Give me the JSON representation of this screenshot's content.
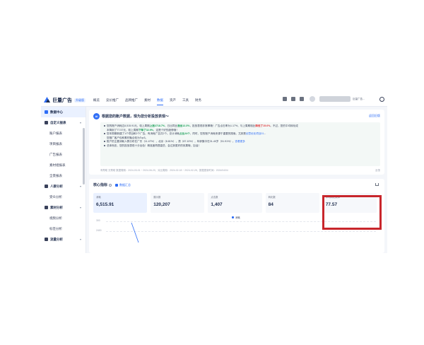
{
  "app": {
    "logo_text": "巨量广告",
    "logo_badge": "升级版"
  },
  "nav": {
    "items": [
      "概览",
      "竞价推广",
      "品牌推广",
      "素材",
      "数据",
      "资产",
      "工具",
      "财务"
    ],
    "active_index": 4
  },
  "top_right": {
    "user_name": "巨量广告..."
  },
  "sidebar": {
    "items": [
      {
        "label": "数据中心",
        "type": "group",
        "active": true
      },
      {
        "label": "自定义报表",
        "type": "group"
      },
      {
        "label": "账户报表",
        "type": "item"
      },
      {
        "label": "项目报表",
        "type": "item"
      },
      {
        "label": "广告报表",
        "type": "item"
      },
      {
        "label": "素材组报表",
        "type": "item"
      },
      {
        "label": "全景报表",
        "type": "item"
      },
      {
        "label": "人群分析",
        "type": "group"
      },
      {
        "label": "受众分析",
        "type": "item"
      },
      {
        "label": "素材分析",
        "type": "group"
      },
      {
        "label": "视频分析",
        "type": "item"
      },
      {
        "label": "标签分析",
        "type": "item"
      },
      {
        "label": "流量分析",
        "type": "group"
      }
    ]
  },
  "insight": {
    "icon_label": "AI",
    "title": "根据您的账户数据，现为您分析投放表现～",
    "link": "返回旧版",
    "lines": [
      {
        "parts": [
          [
            "n",
            "您的账户消耗达"
          ],
          [
            "n",
            "6,515.91元"
          ],
          [
            "n",
            "，较上周期"
          ],
          [
            "g",
            "上涨2718.7%"
          ],
          [
            "n",
            "，日出同比"
          ],
          [
            "g",
            "涨出12.3%"
          ],
          [
            "n",
            "，投放表现非常棒哦！广告点击率为1.17%，与上周期相比"
          ],
          [
            "r",
            "降低了15.6%"
          ],
          [
            "n",
            "。不过，您的平均转化成"
          ]
        ],
        "dot": true
      },
      {
        "parts": [
          [
            "n",
            "本降到了"
          ],
          [
            "n",
            "77.57元"
          ],
          [
            "n",
            "，较上周期"
          ],
          [
            "g",
            "下降了32.9%"
          ],
          [
            "n",
            "，这是个好的趋势哦！"
          ]
        ],
        "dot": false
      },
      {
        "parts": [
          [
            "n",
            "您本周期新建了1个项目和2个广告。有消耗广告共"
          ],
          [
            "n",
            "2"
          ],
          [
            "n",
            "个。总计消耗"
          ],
          [
            "g",
            "占比24个"
          ],
          [
            "n",
            "，同时，您的账户消耗来源于重要的搜索。尤其是"
          ],
          [
            "b",
            "创意优化项目01"
          ],
          [
            "n",
            "..."
          ]
        ],
        "dot": true
      },
      {
        "parts": [
          [
            "n",
            "您推广客户包和素材聚合较为Top3。"
          ]
        ],
        "dot": false
      },
      {
        "parts": [
          [
            "n",
            "账户的主要消耗人群分布在"
          ],
          [
            "n",
            "广东"
          ],
          [
            "n",
            "（11.47%），"
          ],
          [
            "n",
            "北京"
          ],
          [
            "n",
            "（8.81%），"
          ],
          [
            "n",
            "男"
          ],
          [
            "n",
            "（87.10%），年龄集中在"
          ],
          [
            "n",
            "31-40岁"
          ],
          [
            "n",
            "（51.91%）。"
          ],
          [
            "b",
            "查看更多"
          ]
        ],
        "dot": true
      },
      {
        "parts": [
          [
            "n",
            "总体而言，您的投放表现十分出色！精准度再提高些，会达到更好的效果哦，加油！"
          ]
        ],
        "dot": true
      }
    ],
    "footer": "有帮助   无帮助   数据周期：2024-03-01 ~ 2024-06-20，对比周期：2024-02-18 ~ 2024-02-28，数据更新时间：2024/04/04",
    "footer_right": "反馈"
  },
  "core": {
    "title": "核心指标",
    "option": "数据汇总",
    "metrics": [
      {
        "label": "消耗",
        "value": "6,515.91",
        "selected": true
      },
      {
        "label": "展示数",
        "value": "120,207"
      },
      {
        "label": "点击数",
        "value": "1,407"
      },
      {
        "label": "转化数",
        "value": "84"
      },
      {
        "label": "平均转化成本",
        "value": "77.57"
      }
    ]
  },
  "chart_data": {
    "type": "line",
    "series": [
      {
        "name": "消耗",
        "values": []
      }
    ],
    "y_ticks": [
      "300",
      "2400"
    ]
  },
  "colors": {
    "accent": "#2e6df6",
    "highlight": "#c8262c",
    "positive": "#19a058",
    "negative": "#e0373b"
  }
}
